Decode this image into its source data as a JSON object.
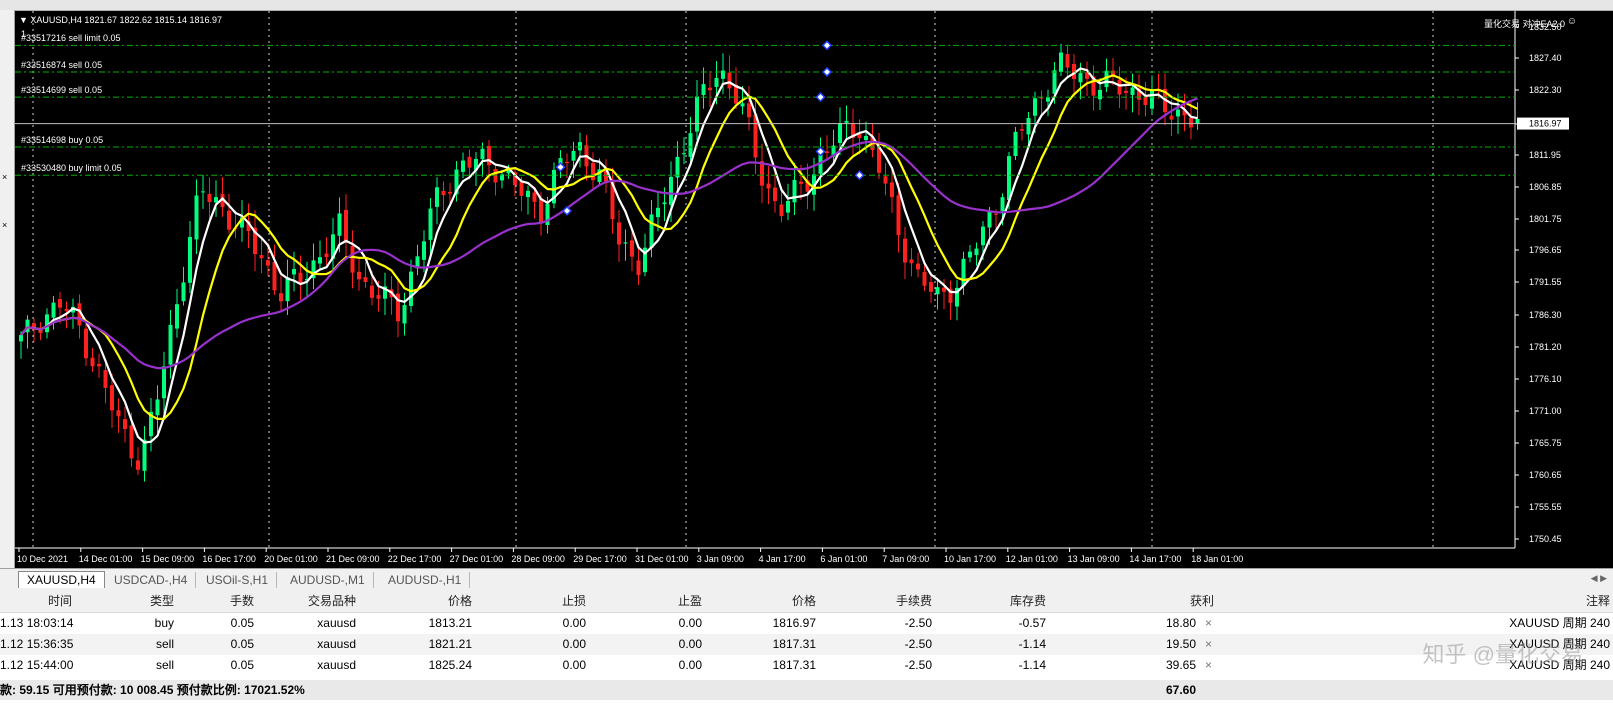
{
  "window": {
    "symbol_info": "XAUUSD,H4  1821.67 1822.62 1815.14 1816.97",
    "ea_name": "量化交易 对冲EA2.0",
    "ea_icon": "smiley-icon",
    "subwindow_no": "1"
  },
  "left_markers": [
    "×",
    "×"
  ],
  "price_axis": {
    "ticks": [
      "1832.50",
      "1827.40",
      "1822.30",
      "1816.97",
      "1811.95",
      "1806.85",
      "1801.75",
      "1796.65",
      "1791.55",
      "1786.30",
      "1781.20",
      "1776.10",
      "1771.00",
      "1765.75",
      "1760.65",
      "1755.55",
      "1750.45"
    ],
    "current": "1816.97"
  },
  "time_axis": {
    "labels": [
      "10 Dec 2021",
      "14 Dec 01:00",
      "15 Dec 09:00",
      "16 Dec 17:00",
      "20 Dec 01:00",
      "21 Dec 09:00",
      "22 Dec 17:00",
      "27 Dec 01:00",
      "28 Dec 09:00",
      "29 Dec 17:00",
      "31 Dec 01:00",
      "3 Jan 09:00",
      "4 Jan 17:00",
      "6 Jan 01:00",
      "7 Jan 09:00",
      "10 Jan 17:00",
      "12 Jan 01:00",
      "13 Jan 09:00",
      "14 Jan 17:00",
      "18 Jan 01:00"
    ]
  },
  "orders": [
    {
      "label": "#33517216 sell limit 0.05",
      "price": 1829.5
    },
    {
      "label": "#33516874 sell 0.05",
      "price": 1825.24
    },
    {
      "label": "#33514699 sell 0.05",
      "price": 1821.21
    },
    {
      "label": "#33514698 buy 0.05",
      "price": 1813.21
    },
    {
      "label": "#33530480 buy limit 0.05",
      "price": 1808.7
    }
  ],
  "chart_data": {
    "type": "candlestick",
    "symbol": "XAUUSD",
    "timeframe": "H4",
    "ylim": [
      1749,
      1835
    ],
    "colors": {
      "bull": "#00ff7f",
      "bear": "#ff2020",
      "ma_fast": "#ffffff",
      "ma_mid": "#ffff00",
      "ma_slow": "#9932cc",
      "order_line": "#00b000",
      "bid_line": "#c0c0c0"
    },
    "anchors": [
      1782,
      1786,
      1788,
      1784,
      1776,
      1768,
      1763,
      1775,
      1792,
      1806,
      1804,
      1800,
      1796,
      1790,
      1792,
      1796,
      1800,
      1792,
      1789,
      1787,
      1797,
      1806,
      1810,
      1811,
      1810,
      1806,
      1803,
      1810,
      1813,
      1809,
      1798,
      1795,
      1803,
      1812,
      1820,
      1826,
      1821,
      1810,
      1803,
      1806,
      1811,
      1815,
      1817,
      1810,
      1800,
      1792,
      1789,
      1792,
      1798,
      1805,
      1815,
      1821,
      1826,
      1825,
      1823,
      1823,
      1822,
      1820,
      1819,
      1817
    ],
    "candle_count": 182,
    "ma_periods": [
      5,
      10,
      30
    ],
    "markers": [
      {
        "bar": 124,
        "price": 1829.5
      },
      {
        "bar": 124,
        "price": 1825.24
      },
      {
        "bar": 123,
        "price": 1821.21
      },
      {
        "bar": 83,
        "price": 1810.0
      },
      {
        "bar": 84,
        "price": 1803.0
      },
      {
        "bar": 123,
        "price": 1812.5
      },
      {
        "bar": 129,
        "price": 1808.7
      }
    ]
  },
  "tabs": [
    {
      "label": "XAUUSD,H4",
      "active": true
    },
    {
      "label": "USDCAD-,H4",
      "active": false
    },
    {
      "label": "USOil-S,H1",
      "active": false
    },
    {
      "label": "AUDUSD-,M1",
      "active": false
    },
    {
      "label": "AUDUSD-,H1",
      "active": false
    }
  ],
  "tab_arrows": "◀ ▶",
  "table": {
    "headers": [
      "时间",
      "类型",
      "手数",
      "交易品种",
      "价格",
      "止损",
      "止盈",
      "价格",
      "手续费",
      "库存费",
      "获利",
      "注释"
    ],
    "rows": [
      [
        "1.13 18:03:14",
        "buy",
        "0.05",
        "xauusd",
        "1813.21",
        "0.00",
        "0.00",
        "1816.97",
        "-2.50",
        "-0.57",
        "18.80",
        "XAUUSD 周期 240"
      ],
      [
        "1.12 15:36:35",
        "sell",
        "0.05",
        "xauusd",
        "1821.21",
        "0.00",
        "0.00",
        "1817.31",
        "-2.50",
        "-1.14",
        "19.50",
        "XAUUSD 周期 240"
      ],
      [
        "1.12 15:44:00",
        "sell",
        "0.05",
        "xauusd",
        "1825.24",
        "0.00",
        "0.00",
        "1817.31",
        "-2.50",
        "-1.14",
        "39.65",
        "XAUUSD 周期 240"
      ]
    ],
    "close_glyph": "×",
    "summary": "款: 59.15  可用预付款: 10 008.45  预付款比例: 17021.52%",
    "total_profit": "67.60"
  },
  "watermark": "知乎 @量化交易"
}
